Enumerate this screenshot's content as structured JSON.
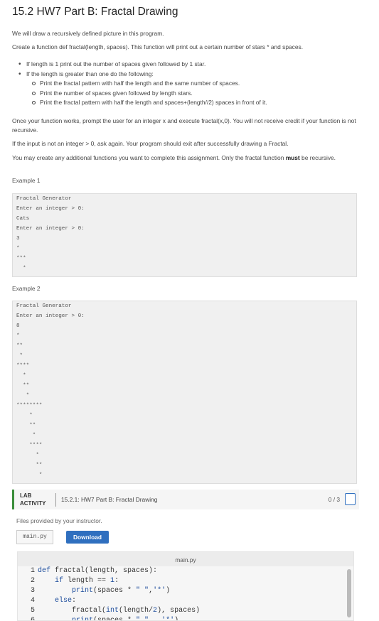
{
  "header": {
    "title": "15.2 HW7 Part B: Fractal Drawing"
  },
  "intro": {
    "p1": "We will draw a recursively defined picture in this program.",
    "p2": "Create a function def fractal(length, spaces). This function will print out a certain number of stars * and spaces."
  },
  "rules": {
    "item1": "If length is 1 print out the number of spaces given followed by 1 star.",
    "item2": "If the length is greater than one do the following:",
    "sub": [
      "Print the fractal pattern with half the length and the same number of spaces.",
      "Print the number of spaces given followed by length stars.",
      "Print the fractal pattern with half the length and spaces+(length//2) spaces in front of it."
    ]
  },
  "instructions": {
    "p3": "Once your function works, prompt the user for an integer x and execute fractal(x,0). You will not receive credit if your function is not recursive.",
    "p4": "If the input is not an integer > 0, ask again. Your program should exit after successfully drawing a Fractal.",
    "p5_a": "You may create any additional functions you want to complete this assignment. Only the fractal function ",
    "p5_bold": "must",
    "p5_b": " be recursive."
  },
  "example1": {
    "label": "Example 1",
    "lines": [
      "Fractal Generator",
      "Enter an integer > 0:",
      "Cats",
      "Enter an integer > 0:",
      "3",
      "*",
      "***",
      "  *"
    ]
  },
  "example2": {
    "label": "Example 2",
    "lines": [
      "Fractal Generator",
      "Enter an integer > 0:",
      "8",
      "*",
      "**",
      " *",
      "****",
      "  *",
      "  **",
      "   *",
      "********",
      "    *",
      "    **",
      "     *",
      "    ****",
      "      *",
      "      **",
      "       *"
    ]
  },
  "lab": {
    "tag_line1": "LAB",
    "tag_line2": "ACTIVITY",
    "title": "15.2.1: HW7 Part B: Fractal Drawing",
    "score": "0 / 3"
  },
  "files": {
    "label": "Files provided by your instructor.",
    "file_name": "main.py",
    "download_label": "Download"
  },
  "editor": {
    "filename": "main.py",
    "line_numbers": [
      "1",
      "2",
      "3",
      "4",
      "5",
      "6"
    ]
  },
  "colors": {
    "accent": "#2f6fbf",
    "lab_border": "#3a8d3a"
  }
}
